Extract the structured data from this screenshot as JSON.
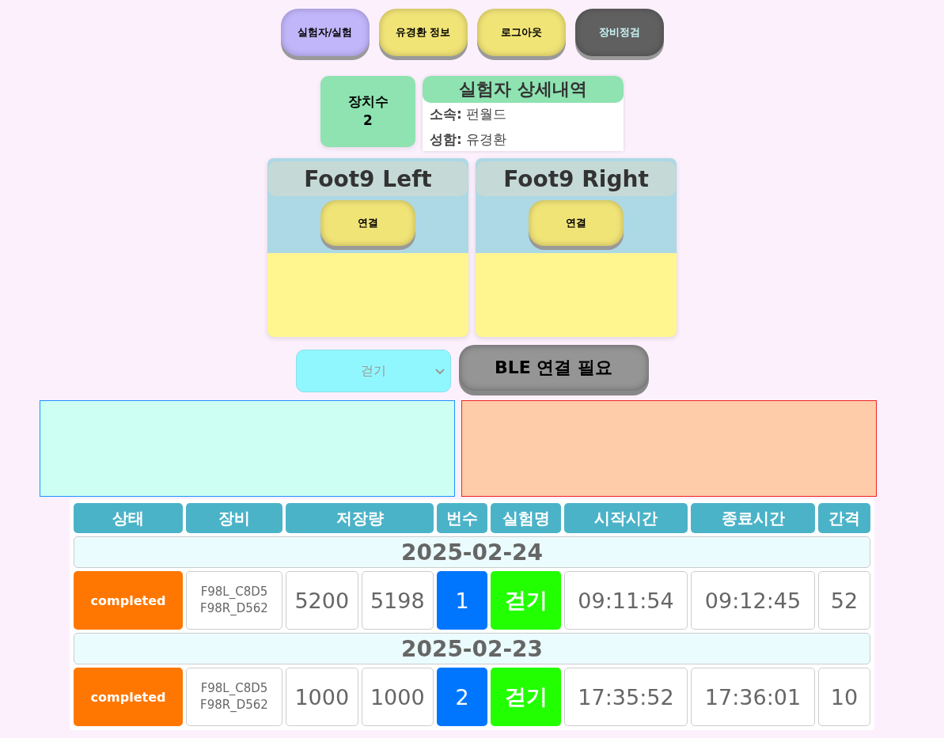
{
  "nav": [
    {
      "label": "실험자/실험",
      "kind": "purple"
    },
    {
      "label": "유경환 정보",
      "kind": "yellow"
    },
    {
      "label": "로그아웃",
      "kind": "yellow"
    },
    {
      "label": "장비정검",
      "kind": "dark"
    }
  ],
  "device_count": {
    "label": "장치수",
    "value": "2"
  },
  "details": {
    "title": "실험자 상세내역",
    "fields": [
      {
        "label": "소속:",
        "value": "펀월드"
      },
      {
        "label": "성함:",
        "value": "유경환"
      }
    ]
  },
  "devices": [
    {
      "name": "Foot9 Left",
      "button": "연결"
    },
    {
      "name": "Foot9 Right",
      "button": "연결"
    }
  ],
  "experiment_select": {
    "value": "걷기",
    "disabled": true
  },
  "ble_button": "BLE 연결 필요",
  "table": {
    "columns": [
      "상태",
      "장비",
      "저장량",
      "번수",
      "실험명",
      "시작시간",
      "종료시간",
      "간격"
    ],
    "groups": [
      {
        "date": "2025-02-24",
        "status": "completed",
        "device": [
          "F98L_C8D5",
          "F98R_D562"
        ],
        "rows": [
          {
            "stored_1": "5200",
            "stored_2": "5198",
            "run": "1",
            "name": "걷기",
            "start": "09:11:54",
            "end": "09:12:45",
            "interval": "52"
          }
        ]
      },
      {
        "date": "2025-02-23",
        "status": "completed",
        "device": [
          "F98L_C8D5",
          "F98R_D562"
        ],
        "rows": [
          {
            "stored_1": "1000",
            "stored_2": "1000",
            "run": "2",
            "name": "걷기",
            "start": "17:35:52",
            "end": "17:36:01",
            "interval": "10"
          }
        ]
      }
    ]
  }
}
